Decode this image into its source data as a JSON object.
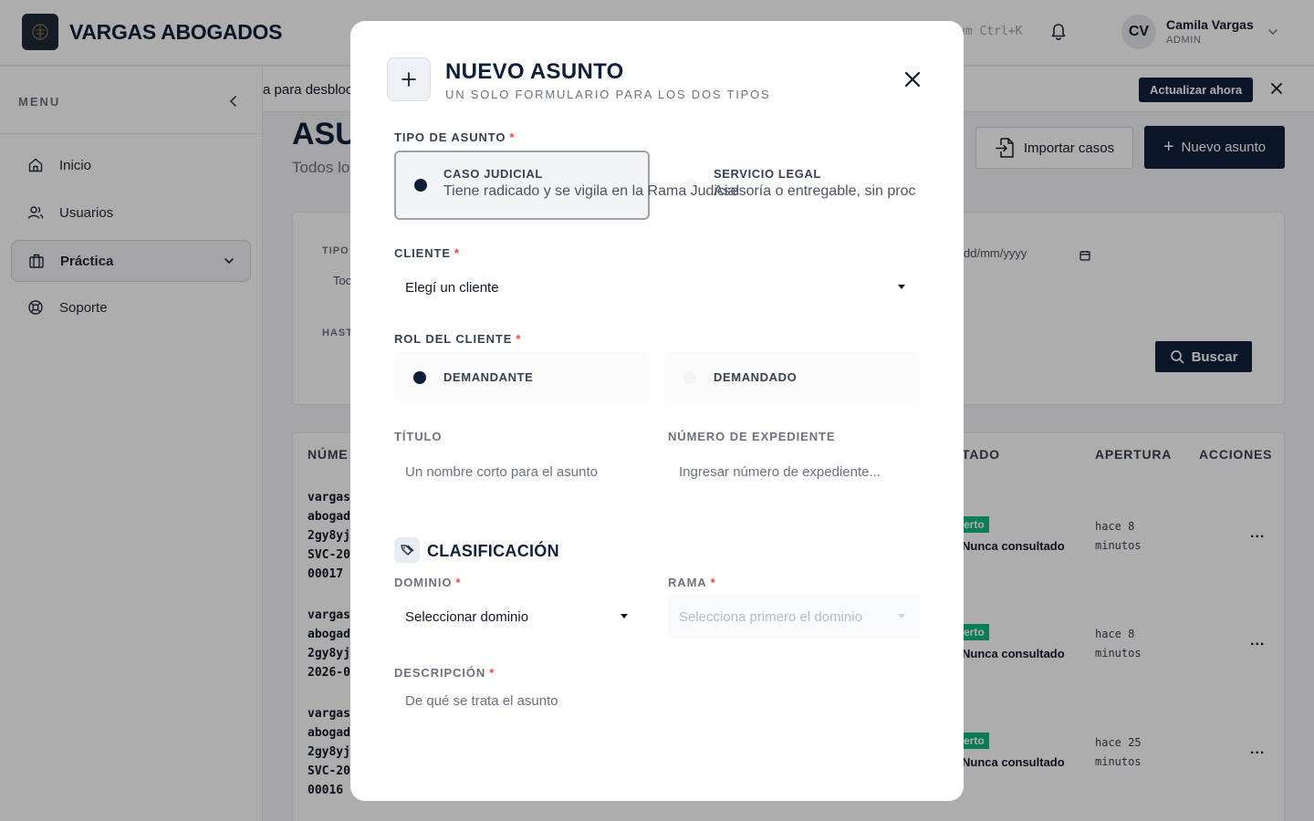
{
  "header": {
    "brand": "VARGAS ABOGADOS",
    "search_hint": "um Ctrl+K",
    "user": {
      "initials": "CV",
      "name": "Camila Vargas",
      "role": "ADMIN"
    }
  },
  "sidebar": {
    "menu_label": "MENU",
    "items": [
      {
        "label": "Inicio",
        "icon": "home-icon"
      },
      {
        "label": "Usuarios",
        "icon": "users-icon"
      },
      {
        "label": "Práctica",
        "icon": "briefcase-icon",
        "active": true
      },
      {
        "label": "Soporte",
        "icon": "lifebuoy-icon"
      }
    ]
  },
  "banner": {
    "text": "a para desbloc",
    "update_button": "Actualizar ahora"
  },
  "page": {
    "title": "ASU",
    "subtitle": "Todos lo",
    "import_button": "Importar casos",
    "new_button": "Nuevo asunto"
  },
  "filters": {
    "tipo_label": "TIPO",
    "tipo_value": "Toc",
    "hasta_label": "HAST",
    "date_placeholder": "dd/mm/yyyy",
    "search_button": "Buscar"
  },
  "table": {
    "headers": {
      "numero": "NÚME",
      "estado": "TADO",
      "apertura": "APERTURA",
      "acciones": "ACCIONES"
    },
    "rows": [
      {
        "numero": "vargas\nabogad\n2gy8yj\nSVC-20\n00017",
        "badge": "erto",
        "consulted": "Nunca consultado",
        "apertura": "hace 8\nminutos"
      },
      {
        "numero": "vargas\nabogad\n2gy8yj\n2026-0",
        "badge": "erto",
        "consulted": "Nunca consultado",
        "apertura": "hace 8\nminutos"
      },
      {
        "numero": "vargas\nabogad\n2gy8yj\nSVC-20\n00016",
        "badge": "erto",
        "consulted": "Nunca consultado",
        "apertura": "hace 25\nminutos"
      }
    ],
    "row_actions": "..."
  },
  "modal": {
    "title": "NUEVO ASUNTO",
    "subtitle": "UN SOLO FORMULARIO PARA LOS DOS TIPOS",
    "tipo_label": "TIPO DE ASUNTO",
    "required_mark": "*",
    "tipo_options": [
      {
        "title": "CASO JUDICIAL",
        "description": "Tiene radicado y se vigila en la Rama Judicial",
        "selected": true
      },
      {
        "title": "SERVICIO LEGAL",
        "description": "Asesoría o entregable, sin proc",
        "selected": false
      }
    ],
    "cliente_label": "CLIENTE",
    "cliente_value": "Elegí un cliente",
    "rol_label": "ROL DEL CLIENTE",
    "rol_options": [
      {
        "label": "DEMANDANTE",
        "selected": true
      },
      {
        "label": "DEMANDADO",
        "selected": false
      }
    ],
    "titulo_label": "TÍTULO",
    "titulo_placeholder": "Un nombre corto para el asunto",
    "expediente_label": "NÚMERO DE EXPEDIENTE",
    "expediente_placeholder": "Ingresar número de expediente...",
    "clasificacion_title": "CLASIFICACIÓN",
    "dominio_label": "DOMINIO",
    "dominio_value": "Seleccionar dominio",
    "rama_label": "RAMA",
    "rama_placeholder": "Selecciona primero el dominio",
    "descripcion_label": "DESCRIPCIÓN",
    "descripcion_placeholder": "De qué se trata el asunto"
  }
}
